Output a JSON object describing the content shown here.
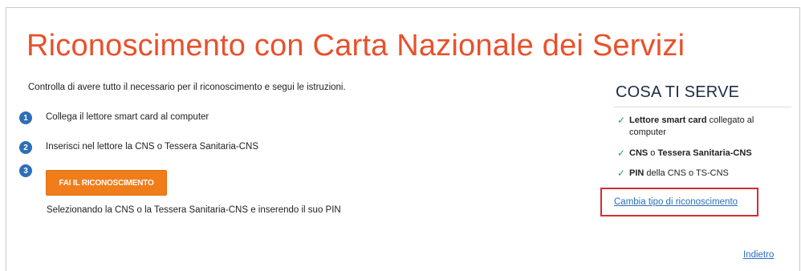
{
  "page": {
    "title": "Riconoscimento con Carta Nazionale dei Servizi",
    "intro": "Controlla di avere tutto il necessario per il riconoscimento e segui le istruzioni."
  },
  "steps": [
    {
      "number": "1",
      "text": "Collega il lettore smart card al computer"
    },
    {
      "number": "2",
      "text": "Inserisci nel lettore la CNS o Tessera Sanitaria-CNS"
    },
    {
      "number": "3",
      "text": ""
    }
  ],
  "action": {
    "button_label": "FAI IL RICONOSCIMENTO",
    "note": "Selezionando la CNS o la Tessera Sanitaria-CNS e inserendo il suo PIN"
  },
  "sidebar": {
    "title": "COSA TI SERVE",
    "requirements": [
      {
        "bold": "Lettore smart card",
        "rest": " collegato al computer"
      },
      {
        "bold": "CNS",
        "rest": " o ",
        "bold2": "Tessera Sanitaria-CNS"
      },
      {
        "bold": "PIN",
        "rest": " della CNS o TS-CNS"
      }
    ],
    "change_link": "Cambia tipo di riconoscimento"
  },
  "footer": {
    "back_link": "Indietro"
  },
  "colors": {
    "title": "#e8512c",
    "button": "#f07d1a",
    "step_badge": "#2d6fb6",
    "check": "#29a04a",
    "link": "#2a6ebd",
    "highlight_border": "#d12d35"
  },
  "icons": {
    "check": "check-icon"
  }
}
